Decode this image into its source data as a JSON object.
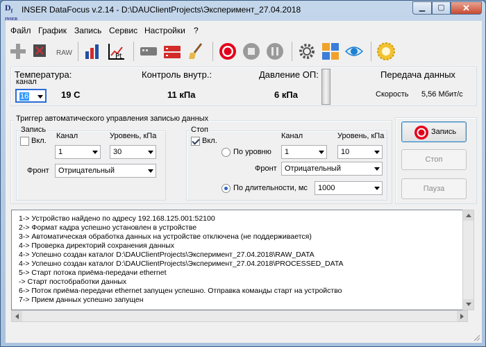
{
  "window": {
    "logo_letters": "D",
    "logo_sub": "INSER",
    "title": "INSER DataFocus v.2.14 - D:\\DAUClientProjects\\Эксперимент_27.04.2018",
    "min_glyph": "▁",
    "max_glyph": "▢",
    "close_glyph": "✕"
  },
  "menu": [
    "Файл",
    "График",
    "Запись",
    "Сервис",
    "Настройки",
    "?"
  ],
  "toolbar": {
    "raw_label": "RAW",
    "pt_label": "Pt",
    "icons": [
      "add-icon",
      "raw-icon",
      "bar-chart-icon",
      "pt-chart-icon",
      "device-icon",
      "device-red-icon",
      "brush-icon",
      "record-icon",
      "stop-icon",
      "pause-icon",
      "gear-icon",
      "calculator-icon",
      "eye-icon",
      "settings-badge-icon"
    ],
    "accent": "#e3001b"
  },
  "status": {
    "temperature_label": "Температура:",
    "channel_label": "канал",
    "channel_value": "16",
    "temperature_value": "19 С",
    "internal_label": "Контроль внутр.:",
    "internal_value": "11 кПа",
    "pressure_label": "Давление ОП:",
    "pressure_value": "6 кПа",
    "transfer_label": "Передача данных",
    "speed_label": "Скорость",
    "speed_value": "5,56 Мбит/с",
    "level_fraction": 0.0
  },
  "trigger": {
    "group_title": "Триггер автоматического управления записью данных",
    "start": {
      "title": "Запись",
      "enabled_label": "Вкл.",
      "enabled": false,
      "channel_label": "Канал",
      "level_label": "Уровень, кПа",
      "channel_value": "1",
      "level_value": "30",
      "front_label": "Фронт",
      "front_value": "Отрицательный"
    },
    "stop": {
      "title": "Стоп",
      "enabled_label": "Вкл.",
      "enabled": true,
      "channel_label": "Канал",
      "level_label": "Уровень, кПа",
      "by_level_label": "По уровню",
      "by_level_selected": false,
      "channel_value": "1",
      "level_value": "10",
      "front_label": "Фронт",
      "front_value": "Отрицательный",
      "by_duration_label": "По длительности, мс",
      "by_duration_selected": true,
      "duration_value": "1000"
    }
  },
  "controls": {
    "record_label": "Запись",
    "stop_label": "Стоп",
    "pause_label": "Пауза"
  },
  "log": [
    "1-> Устройство найдено по адресу 192.168.125.001:52100",
    "2-> Формат кадра успешно установлен в устройстве",
    "3-> Автоматическая обработка данных на устройстве отключена (не поддерживается)",
    "4-> Проверка директорий сохранения данных",
    "4-> Успешно создан каталог D:\\DAUClientProjects\\Эксперимент_27.04.2018\\RAW_DATA",
    "4-> Успешно создан каталог D:\\DAUClientProjects\\Эксперимент_27.04.2018\\PROCESSED_DATA",
    "5-> Старт потока приёма-передачи ethernet",
    "-> Старт постобработки данных",
    "6-> Поток приёма-передачи ethernet запущен успешно. Отправка команды старт на устройство",
    "7-> Прием данных успешно запущен"
  ]
}
